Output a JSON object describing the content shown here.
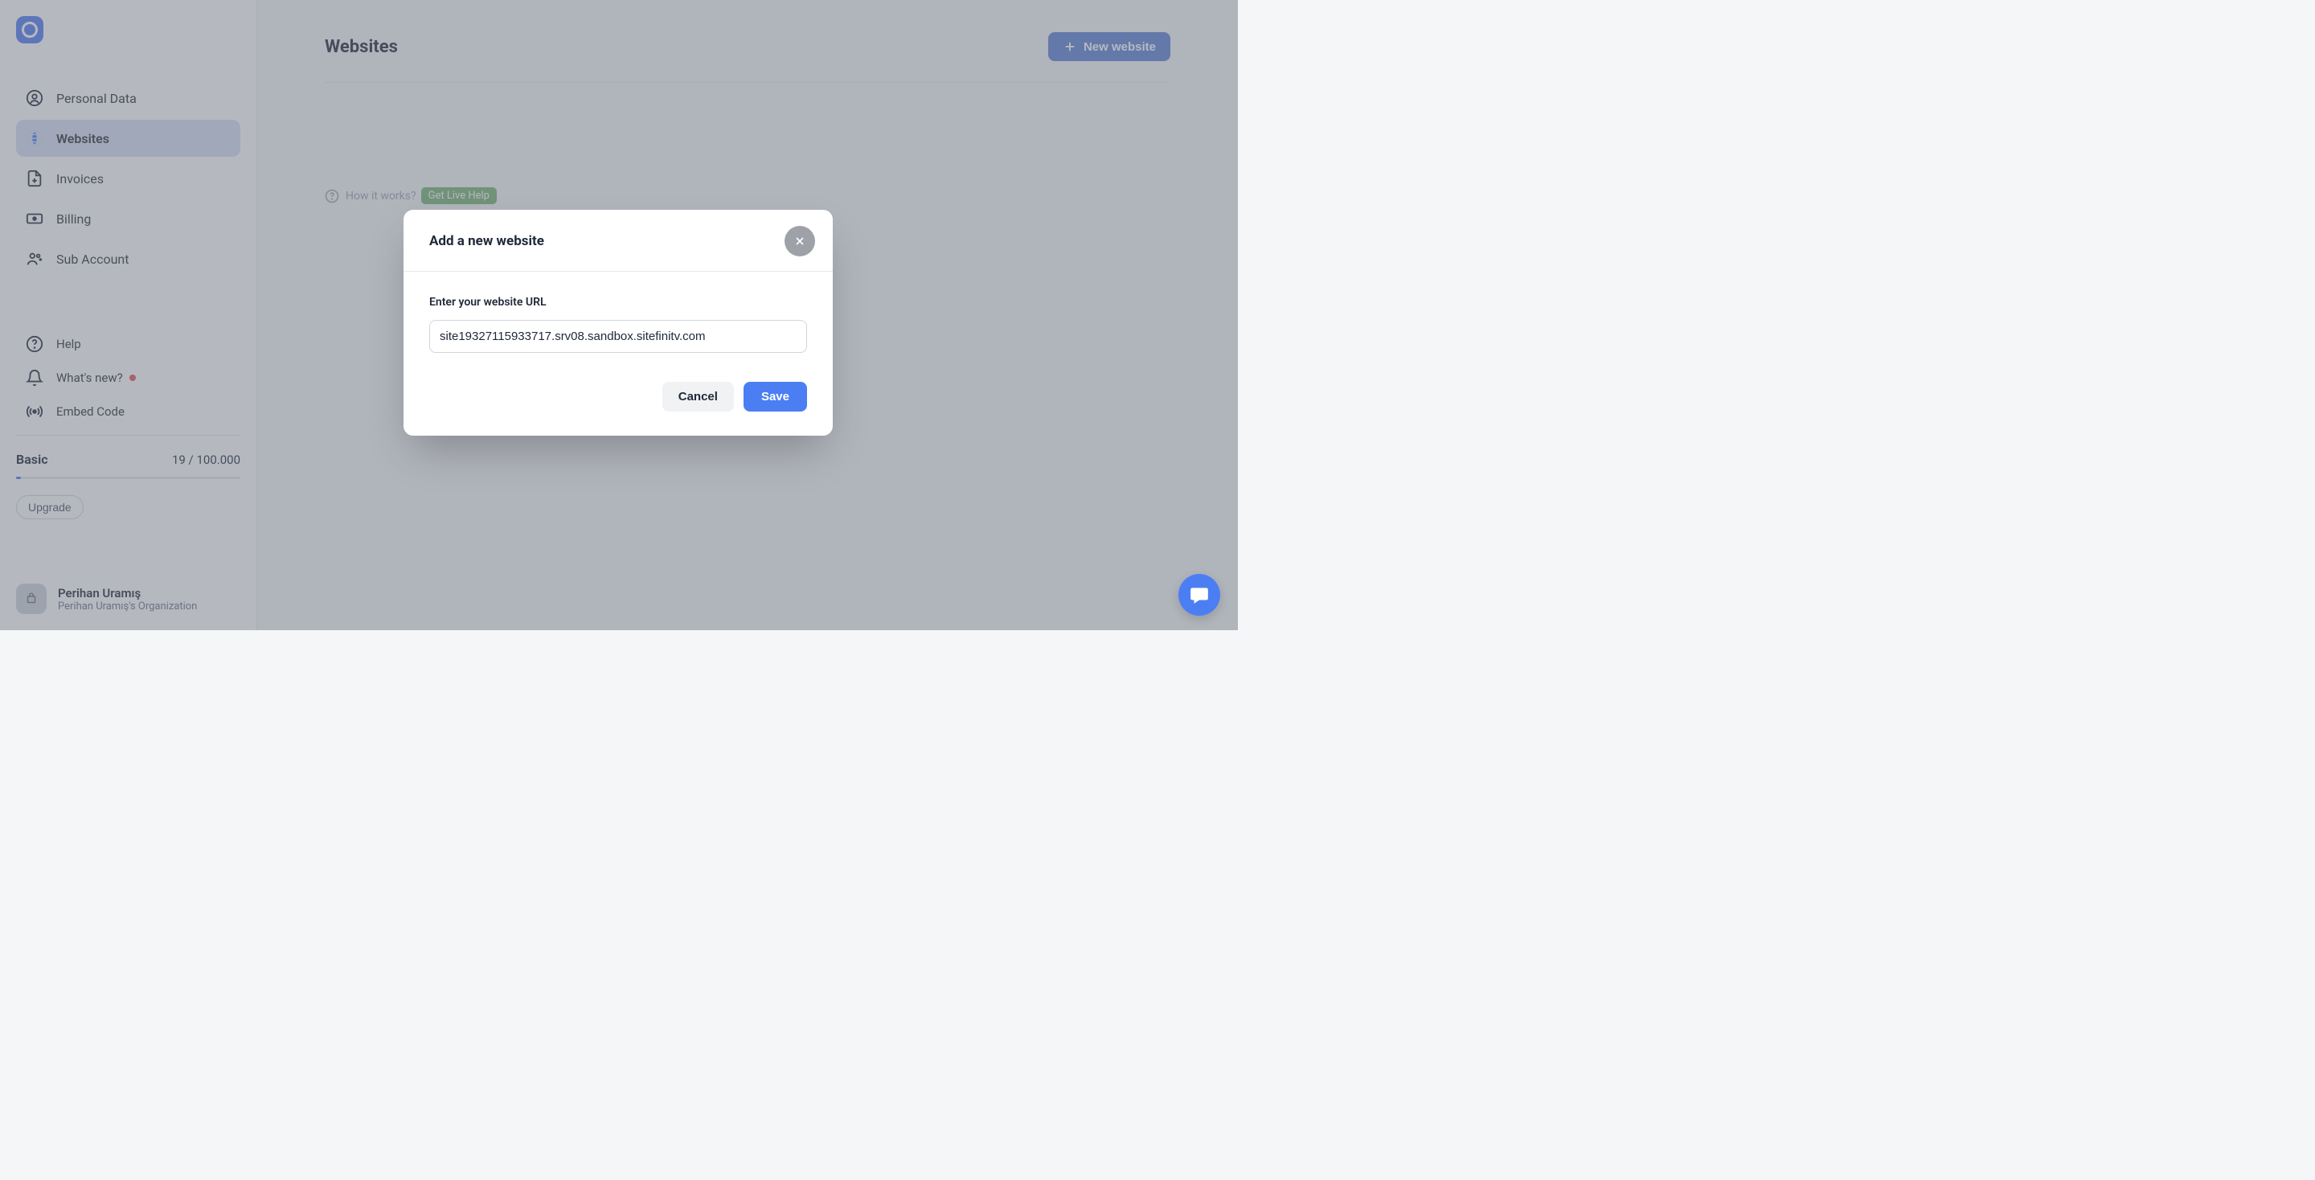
{
  "sidebar": {
    "nav": [
      {
        "label": "Personal Data"
      },
      {
        "label": "Websites"
      },
      {
        "label": "Invoices"
      },
      {
        "label": "Billing"
      },
      {
        "label": "Sub Account"
      }
    ],
    "secondary": [
      {
        "label": "Help"
      },
      {
        "label": "What's new?"
      },
      {
        "label": "Embed Code"
      }
    ],
    "plan": {
      "name": "Basic",
      "usage": "19 / 100.000",
      "upgrade_label": "Upgrade"
    },
    "user": {
      "name": "Perihan Uramış",
      "org": "Perihan Uramış's Organization"
    }
  },
  "main": {
    "title": "Websites",
    "new_website_label": "New website",
    "how_it_works": "How it works?",
    "live_help": "Get Live Help"
  },
  "modal": {
    "title": "Add a new website",
    "input_label": "Enter your website URL",
    "input_value": "site19327115933717.srv08.sandbox.sitefinitv.com",
    "cancel_label": "Cancel",
    "save_label": "Save"
  }
}
